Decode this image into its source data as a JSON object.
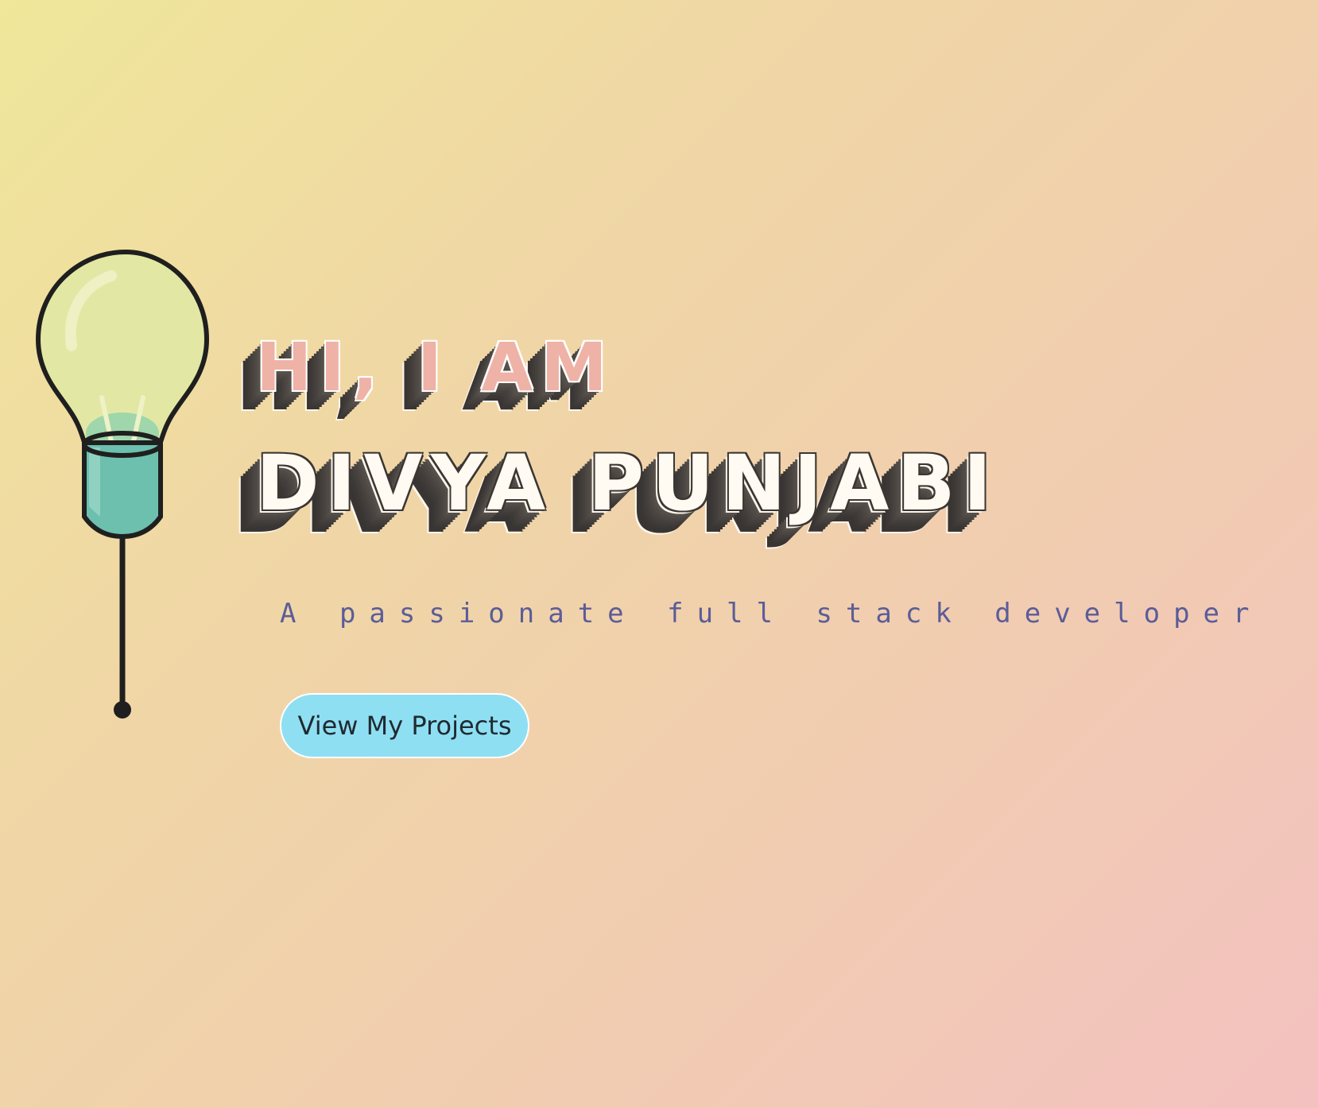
{
  "hero": {
    "greeting": "HI, I AM",
    "name": "DIVYA PUNJABI",
    "tagline": "A passionate full stack developer",
    "cta_label": "View My Projects"
  },
  "icons": {
    "bulb": "lightbulb-icon"
  },
  "colors": {
    "background_start": "#efe79a",
    "background_end": "#f3c1c0",
    "greeting_text": "#efb2a6",
    "name_text": "#fffaf2",
    "tagline_text": "#5b5d98",
    "cta_background": "#8fdff3",
    "bulb_glass": "#e2e8a4",
    "bulb_base": "#6dbfae"
  }
}
